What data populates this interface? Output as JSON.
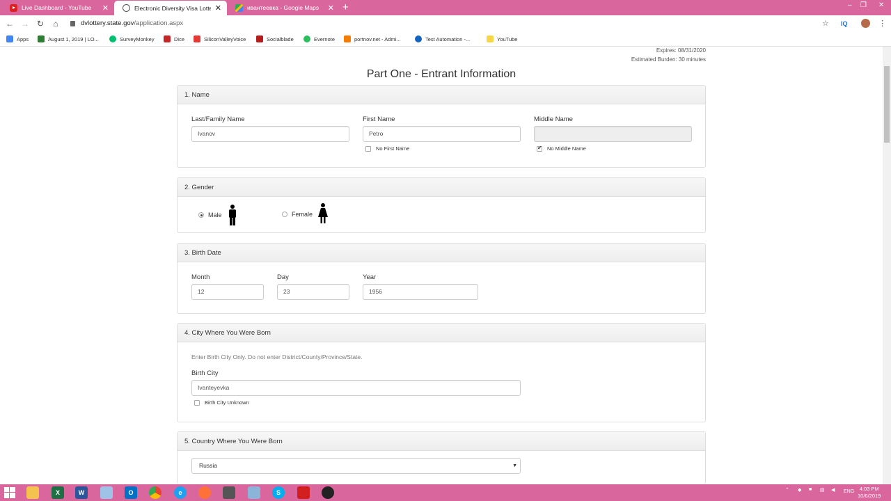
{
  "browser": {
    "tabs": [
      {
        "title": "Live Dashboard - YouTube",
        "icon": "youtube-icon",
        "active": false
      },
      {
        "title": "Electronic Diversity Visa Lottery",
        "icon": "globe-icon",
        "active": true
      },
      {
        "title": "ивантеевка - Google Maps",
        "icon": "maps-icon",
        "active": false
      }
    ],
    "new_tab": "+",
    "close_glyph": "✕",
    "window_controls": {
      "minimize": "‒",
      "restore": "❐",
      "close": "✕"
    },
    "url_host": "dvlottery.state.gov",
    "url_path": "/application.aspx",
    "extension_label": "IQ",
    "bookmarks": [
      {
        "label": "Apps",
        "color": "#4285f4"
      },
      {
        "label": "August 1, 2019 | LO...",
        "color": "#2e7d32"
      },
      {
        "label": "SurveyMonkey",
        "color": "#00bf6f"
      },
      {
        "label": "Dice",
        "color": "#c62828"
      },
      {
        "label": "SiliconValleyVoice",
        "color": "#e53935"
      },
      {
        "label": "Socialblade",
        "color": "#b71c1c"
      },
      {
        "label": "Evernote",
        "color": "#2dbe60"
      },
      {
        "label": "portnov.net - Admi...",
        "color": "#f57c00"
      },
      {
        "label": "Test Automation -...",
        "color": "#1565c0"
      },
      {
        "label": "YouTube",
        "color": "#f9d648"
      }
    ]
  },
  "page": {
    "expires": "Expires: 08/31/2020",
    "burden": "Estimated Burden: 30 minutes",
    "title": "Part One - Entrant Information"
  },
  "name_section": {
    "header": "1. Name",
    "last_label": "Last/Family Name",
    "last_value": "Ivanov",
    "first_label": "First Name",
    "first_value": "Petro",
    "no_first_label": "No First Name",
    "no_first_checked": false,
    "middle_label": "Middle Name",
    "middle_value": "",
    "no_middle_label": "No Middle Name",
    "no_middle_checked": true
  },
  "gender_section": {
    "header": "2. Gender",
    "male_label": "Male",
    "female_label": "Female",
    "selected": "Male"
  },
  "birth_section": {
    "header": "3. Birth Date",
    "month_label": "Month",
    "month_value": "12",
    "day_label": "Day",
    "day_value": "23",
    "year_label": "Year",
    "year_value": "1956"
  },
  "city_section": {
    "header": "4. City Where You Were Born",
    "hint": "Enter Birth City Only. Do not enter District/County/Province/State.",
    "city_label": "Birth City",
    "city_value": "Ivanteyevka",
    "unknown_label": "Birth City Unknown",
    "unknown_checked": false
  },
  "country_section": {
    "header": "5. Country Where You Were Born",
    "selected": "Russia"
  },
  "taskbar": {
    "apps": [
      "windows-start",
      "file-explorer",
      "excel",
      "word",
      "notepad",
      "outlook",
      "chrome",
      "internet-explorer",
      "firefox",
      "screen-capture",
      "paint",
      "skype",
      "acrobat",
      "obs"
    ],
    "lang": "ENG",
    "time": "4:03 PM",
    "date": "10/6/2019"
  }
}
